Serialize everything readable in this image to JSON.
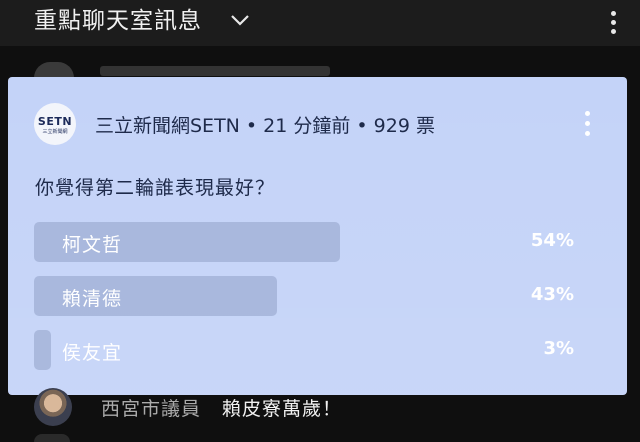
{
  "header": {
    "title": "重點聊天室訊息",
    "dropdown_icon": "chevron-down-icon",
    "menu_icon": "more-vert-icon"
  },
  "poll": {
    "channel_logo_text": "SETN",
    "channel_logo_sub": "三立新聞網",
    "meta": "三立新聞網SETN • 21 分鐘前 • 929 票",
    "question": "你覺得第二輪誰表現最好？",
    "options": [
      {
        "label": "柯文哲",
        "percent": "54%",
        "fraction": 0.54
      },
      {
        "label": "賴清德",
        "percent": "43%",
        "fraction": 0.43
      },
      {
        "label": "侯友宜",
        "percent": "3%",
        "fraction": 0.03
      }
    ],
    "menu_icon": "more-vert-icon",
    "colors": {
      "card": "#c4d3f8",
      "bar": "#5f6e96"
    }
  },
  "chat": {
    "author": "西宮市議員",
    "message": "賴皮寮萬歲！"
  }
}
